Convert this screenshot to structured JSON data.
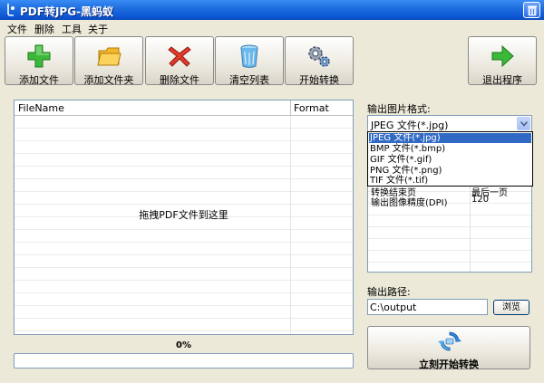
{
  "window": {
    "title": "PDF转JPG-黑蚂蚁"
  },
  "menu": [
    "文件",
    "删除",
    "工具",
    "关于"
  ],
  "toolbar": {
    "add_file": "添加文件",
    "add_folder": "添加文件夹",
    "delete_file": "删除文件",
    "clear_list": "清空列表",
    "start_convert": "开始转换",
    "exit": "退出程序"
  },
  "file_list": {
    "columns": [
      "FileName",
      "Format"
    ],
    "drop_hint": "拖拽PDF文件到这里"
  },
  "progress": {
    "label": "0%",
    "value": 0
  },
  "output_format": {
    "label": "输出图片格式:",
    "selected": "JPEG 文件(*.jpg)",
    "options": [
      "JPEG 文件(*.jpg)",
      "BMP 文件(*.bmp)",
      "GIF 文件(*.gif)",
      "PNG 文件(*.png)",
      "TIF 文件(*.tif)"
    ]
  },
  "properties": [
    {
      "name": "转换结束页",
      "value": "最后一页"
    },
    {
      "name": "输出图像精度(DPI)",
      "value": "120"
    }
  ],
  "output_path": {
    "label": "输出路径:",
    "value": "C:\\output",
    "browse": "浏览"
  },
  "convert_now": "立刻开始转换",
  "colors": {
    "titlebar": "#0b55d5",
    "selection": "#316ac5",
    "window_bg": "#ece9d8"
  }
}
